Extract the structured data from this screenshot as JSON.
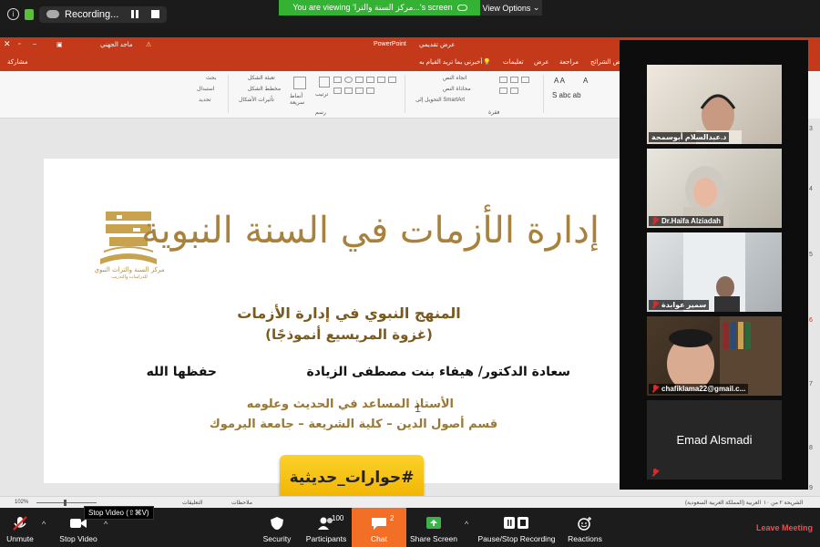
{
  "recording_bar": {
    "status": "Recording...",
    "viewing_banner": "You are viewing 'مركز السنة والترا...'s screen",
    "view_options": "View Options"
  },
  "powerpoint": {
    "app_name": "PowerPoint",
    "doc_title": "عرض تقديمي",
    "user_name": "ماجد الجهني",
    "share": "مشاركة",
    "tell_me": "أخبرني بما تريد القيام به",
    "tabs": [
      "عرض الشرائح",
      "مراجعة",
      "عرض",
      "تعليمات"
    ],
    "ribbon": {
      "find": "بحث",
      "replace": "استبدال",
      "select": "تحديد",
      "arrange": "ترتيب",
      "quick_styles": "أنماط سريعة",
      "drawing": "رسم",
      "paragraph": "فقرة",
      "smartart": "التحويل إلى SmartArt",
      "text_direction": "اتجاه النص",
      "align_text": "محاذاة النص",
      "shape_fill": "تعبئة الشكل",
      "shape_outline": "مخطط الشكل",
      "shape_effects": "تأثيرات الأشكال"
    },
    "status": {
      "zoom": "102%",
      "notes": "ملاحظات",
      "comments": "التعليقات",
      "slide_info": "الشريحة ٢ من ١٠",
      "language": "العربية (المملكة العربية السعودية)"
    },
    "ruler_numbers": [
      "3",
      "4",
      "5",
      "6",
      "7",
      "8",
      "9"
    ]
  },
  "slide": {
    "logo_text": "مركز السنة والتراث النبوي",
    "logo_subtext": "للدراسات والتدريب",
    "title": "إدارة الأزمات في السنة النبوية",
    "subtitle": "المنهج النبوي في إدارة الأزمات",
    "subtitle2": "(غزوة المريسيع أنموذجًا)",
    "author": "سعادة الدكتور/ هيفاء بنت مصطفى الزيادة",
    "honorific": "حفظها الله",
    "position": "الأستاذ المساعد في الحديث وعلومه",
    "department": "قسم أصول الدين – كلية الشريعة – جامعة اليرموك",
    "hashtag": "#حوارات_حديثية"
  },
  "participants": [
    {
      "name": "د.عبدالسلام أبوسمحة",
      "muted": false
    },
    {
      "name": "Dr.Haifa Alziadah",
      "muted": true
    },
    {
      "name": "سمير عوابدة",
      "muted": true
    },
    {
      "name": "chafiklama22@gmail.c...",
      "muted": true
    },
    {
      "name": "Emad Alsmadi",
      "muted": true
    }
  ],
  "toolbar": {
    "unmute": "Unmute",
    "stop_video": "Stop Video",
    "stop_video_tooltip": "Stop Video (⇧⌘V)",
    "security": "Security",
    "participants": "Participants",
    "participants_count": "100",
    "chat": "Chat",
    "chat_count": "2",
    "share_screen": "Share Screen",
    "pause_recording": "Pause/Stop Recording",
    "reactions": "Reactions",
    "leave": "Leave Meeting"
  },
  "colors": {
    "zoom_green": "#34b233",
    "ppt_red": "#c4391a",
    "gold": "#a8823c",
    "chat_orange": "#f46f26",
    "leave_red": "#f24b4b"
  }
}
